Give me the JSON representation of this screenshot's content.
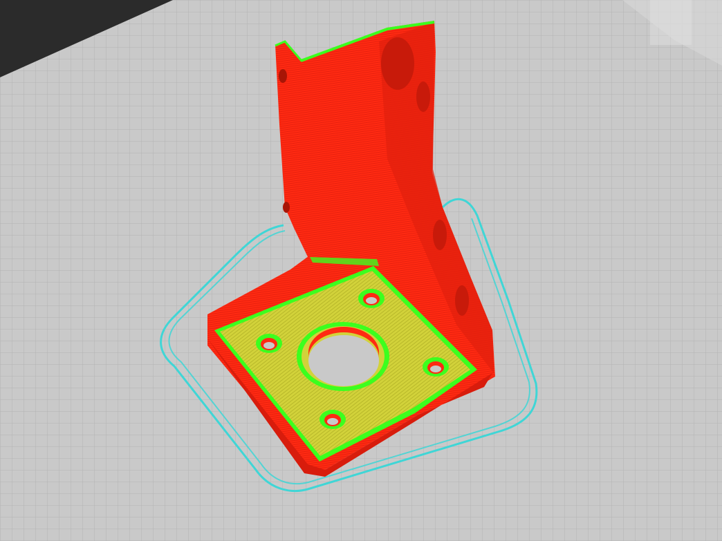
{
  "app": {
    "view": "slicer-preview-3d"
  },
  "colors": {
    "background": "#2b2b2b",
    "bed": "#c9c9c9",
    "bed_grid": "#b3b3b3",
    "perimeter": "#ff2a12",
    "perimeter_shade": "#d81c0c",
    "external_perimeter": "#3cff1e",
    "top_solid_infill": "#d2d23a",
    "skirt": "#3fd6d6"
  },
  "icons": {
    "bed": "print-bed-grid",
    "model": "sliced-bracket-toolpaths",
    "skirt": "skirt-outline"
  }
}
